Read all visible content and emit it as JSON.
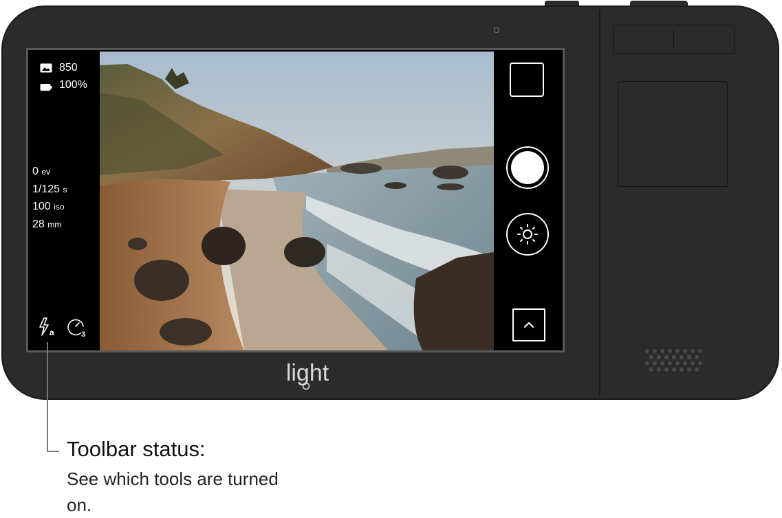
{
  "status": {
    "photo_count": "850",
    "battery": "100%"
  },
  "exposure": {
    "ev_value": "0",
    "ev_unit": "ev",
    "shutter_value": "1/125",
    "shutter_unit": "s",
    "iso_value": "100",
    "iso_unit": "iso",
    "focal_value": "28",
    "focal_unit": "mm"
  },
  "toolbar": {
    "flash_mode_letter": "a",
    "timer_seconds": "3"
  },
  "brand": {
    "logo_text": "light"
  },
  "callout": {
    "title": "Toolbar status:",
    "description": "See which tools are turned on."
  },
  "icons": {
    "photos": "image-icon",
    "battery": "battery-icon",
    "flash": "flash-auto-icon",
    "timer": "timer-icon",
    "gallery": "gallery-thumbnail-icon",
    "shutter": "shutter-button-icon",
    "settings": "sun-brightness-icon",
    "expand": "chevron-up-icon"
  }
}
